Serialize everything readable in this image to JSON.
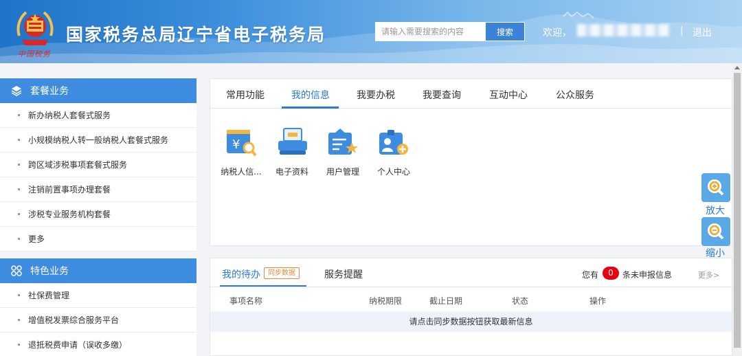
{
  "header": {
    "site_title": "国家税务总局辽宁省电子税务局",
    "emblem_script": "中国税务",
    "search": {
      "placeholder": "请输入需要搜索的内容",
      "button_label": "搜索"
    },
    "welcome": "欢迎，",
    "separator": "|",
    "logout_label": "退出"
  },
  "sidebar": {
    "sections": [
      {
        "title": "套餐业务",
        "icon": "layers-icon",
        "items": [
          "新办纳税人套餐式服务",
          "小规模纳税人转一般纳税人套餐式服务",
          "跨区域涉税事项套餐式服务",
          "注销前置事项办理套餐",
          "涉税专业服务机构套餐",
          "更多"
        ]
      },
      {
        "title": "特色业务",
        "icon": "grid-icon",
        "items": [
          "社保费管理",
          "增值税发票综合服务平台",
          "退抵税费申请（误收多缴）"
        ]
      }
    ]
  },
  "main_tabs": [
    "常用功能",
    "我的信息",
    "我要办税",
    "我要查询",
    "互动中心",
    "公众服务"
  ],
  "active_tab": "我的信息",
  "apps": [
    {
      "label": "纳税人信...",
      "icon": "taxpayer-info-icon"
    },
    {
      "label": "电子资料",
      "icon": "scanner-icon"
    },
    {
      "label": "用户管理",
      "icon": "user-management-icon"
    },
    {
      "label": "个人中心",
      "icon": "personal-center-icon"
    }
  ],
  "todo": {
    "tabs": [
      "我的待办",
      "服务提醒"
    ],
    "sync_label": "同步数据",
    "pending_prefix": "您有",
    "pending_count": "0",
    "pending_suffix": "条未申报信息",
    "more_label": "更多>",
    "columns": [
      "事项名称",
      "纳税期限",
      "截止日期",
      "状态",
      "操作"
    ],
    "info_message": "请点击同步数据按钮获取最新信息"
  },
  "zoom": {
    "in_label": "放大",
    "out_label": "缩小"
  },
  "colors": {
    "primary": "#2a7ad6",
    "sidebar_head": "#3d8ce0",
    "badge": "#e60012",
    "sync": "#e38a3c"
  }
}
